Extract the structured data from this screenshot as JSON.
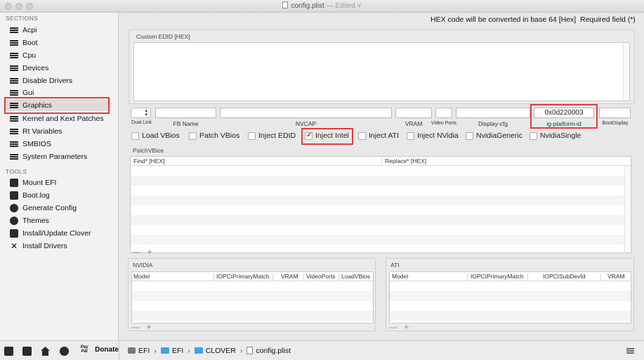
{
  "window": {
    "title": "config.plist",
    "edited": "— Edited ˅"
  },
  "sidebar": {
    "sections_title": "SECTIONS",
    "sections": [
      "Acpi",
      "Boot",
      "Cpu",
      "Devices",
      "Disable Drivers",
      "Graphics",
      "Gui",
      "Kernel and Kext Patches",
      "Rt Variables",
      "SMBIOS",
      "System Parameters"
    ],
    "selected": "Graphics",
    "tools_title": "TOOLS",
    "tools": [
      "Mount EFI",
      "Boot.log",
      "Generate Config",
      "Themes",
      "Install/Update Clover",
      "Install Drivers"
    ],
    "donate_label": "Donate",
    "paypal_text": "Pay Pal"
  },
  "header": {
    "hex_note": "HEX code will be converted in base 64 [Hex]",
    "required_note": "Required field (*)"
  },
  "custom_edid": {
    "label": "Custom EDID [HEX]",
    "value": ""
  },
  "fields": {
    "dual_link": {
      "label": "Dual Link",
      "value": ""
    },
    "fb_name": {
      "label": "FB Name",
      "value": ""
    },
    "nvcap": {
      "label": "NVCAP",
      "value": ""
    },
    "vram": {
      "label": "VRAM",
      "value": ""
    },
    "video_ports": {
      "label": "Video Ports",
      "value": ""
    },
    "display_cfg": {
      "label": "Display-cfg",
      "value": ""
    },
    "ig_platform_id": {
      "label": "ig-platform-id",
      "value": "0x0d220003"
    },
    "boot_display": {
      "label": "BootDisplay",
      "value": ""
    }
  },
  "checkboxes": [
    {
      "label": "Load VBios",
      "checked": false
    },
    {
      "label": "Patch VBios",
      "checked": false
    },
    {
      "label": "Inject EDID",
      "checked": false
    },
    {
      "label": "Inject Intel",
      "checked": true
    },
    {
      "label": "Inject ATI",
      "checked": false
    },
    {
      "label": "Inject NVidia",
      "checked": false
    },
    {
      "label": "NvidiaGeneric",
      "checked": false
    },
    {
      "label": "NvidiaSingle",
      "checked": false
    }
  ],
  "patch_vbios": {
    "label": "PatchVBios",
    "columns": [
      "Find* [HEX]",
      "Replace* [HEX]"
    ]
  },
  "nvidia": {
    "label": "NVIDIA",
    "columns": [
      "Model",
      "IOPCIPrimaryMatch",
      "VRAM",
      "VideoPorts",
      "LoadVBios"
    ]
  },
  "ati": {
    "label": "ATI",
    "columns": [
      "Model",
      "IOPCIPrimaryMatch",
      "IOPCISubDevId",
      "VRAM"
    ]
  },
  "table_controls": {
    "add_remove": "— +"
  },
  "pathbar": {
    "crumbs": [
      "EFI",
      "EFI",
      "CLOVER",
      "config.plist"
    ],
    "separator": "›"
  }
}
